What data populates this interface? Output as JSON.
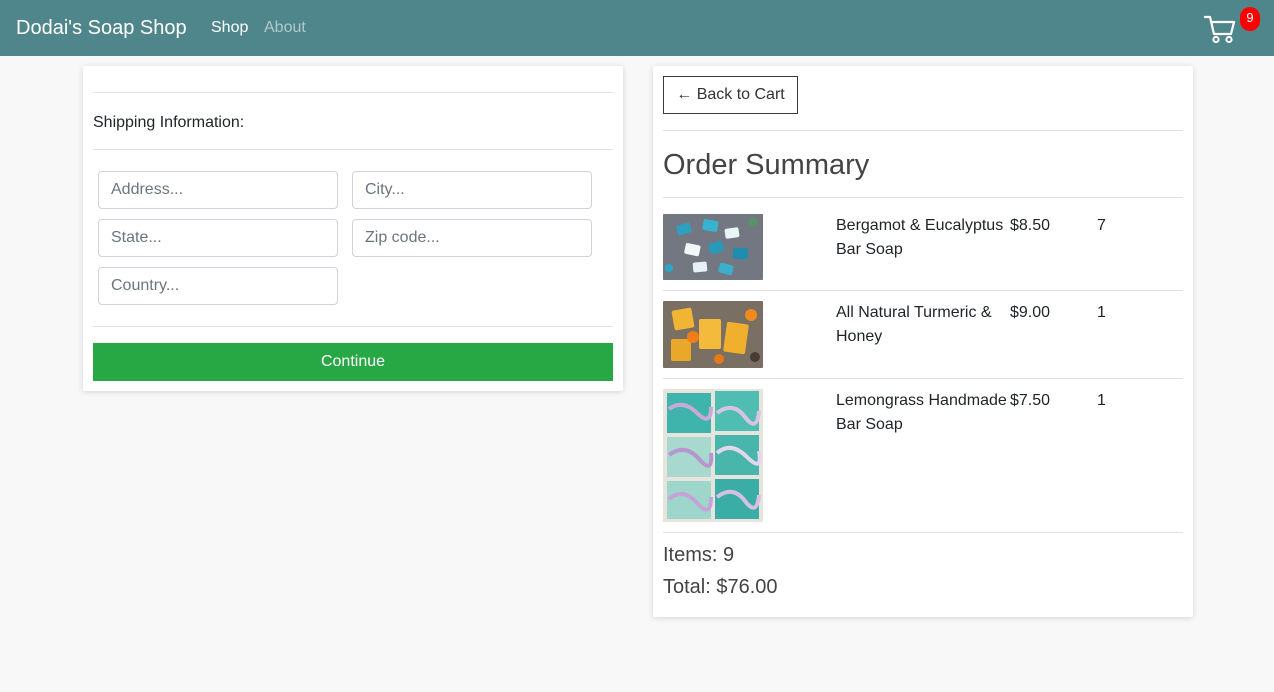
{
  "nav": {
    "brand": "Dodai's Soap Shop",
    "links": [
      {
        "label": "Shop"
      },
      {
        "label": "About"
      }
    ],
    "cart_count": "9",
    "bg_color": "#4f868c"
  },
  "shipping": {
    "title": "Shipping Information:",
    "fields": {
      "address": {
        "placeholder": "Address..."
      },
      "city": {
        "placeholder": "City..."
      },
      "state": {
        "placeholder": "State..."
      },
      "zip": {
        "placeholder": "Zip code..."
      },
      "country": {
        "placeholder": "Country..."
      }
    },
    "continue_label": "Continue",
    "continue_color": "#28a745"
  },
  "summary": {
    "back_label": "← Back to Cart",
    "title": "Order Summary",
    "items": [
      {
        "name": "Bergamot & Eucalyptus Bar Soap",
        "price": "$8.50",
        "qty": "7"
      },
      {
        "name": "All Natural Turmeric & Honey",
        "price": "$9.00",
        "qty": "1"
      },
      {
        "name": "Lemongrass Handmade Bar Soap",
        "price": "$7.50",
        "qty": "1"
      }
    ],
    "items_text": "Items: 9",
    "total_text": "Total: $76.00"
  }
}
